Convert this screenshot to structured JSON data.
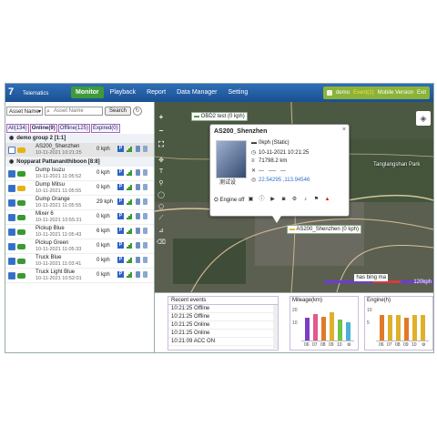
{
  "app": {
    "logo_mark": "7",
    "logo_text": "Telematics",
    "nav": [
      "Monitor",
      "Playback",
      "Report",
      "Data Manager",
      "Setting"
    ],
    "active_nav": "Monitor",
    "user": "demo",
    "event": "Event(1)",
    "mobile": "Mobile Version",
    "exit": "Exit"
  },
  "left": {
    "search_select": "Asset Name",
    "search_placeholder": "Asset Name",
    "search_button": "Search",
    "filters": [
      "All(134)",
      "Online(9)",
      "Offline(125)",
      "Expired(0)"
    ],
    "groups": [
      {
        "label": "demo group 2 [1:1]",
        "rows": [
          {
            "name": "AS200_Shenzhen",
            "time": "10-11-2021 10:21:25",
            "speed": "0 kph",
            "checked": false,
            "color": "#e7b214",
            "selected": true
          }
        ]
      },
      {
        "label": "Nopparat Pattananithiboon [8:8]",
        "rows": [
          {
            "name": "Dump Isuzu",
            "time": "10-11-2021 11:05:52",
            "speed": "0 kph",
            "checked": true,
            "color": "#3a9a2e"
          },
          {
            "name": "Dump Mitsu",
            "time": "10-11-2021 11:05:55",
            "speed": "0 kph",
            "checked": true,
            "color": "#e7b214"
          },
          {
            "name": "Dump Orange",
            "time": "10-11-2021 11:05:55",
            "speed": "29 kph",
            "checked": true,
            "color": "#3a9a2e"
          },
          {
            "name": "Mixer 6",
            "time": "10-11-2021 10:55:31",
            "speed": "0 kph",
            "checked": true,
            "color": "#3a9a2e"
          },
          {
            "name": "Pickup Blue",
            "time": "10-11-2021 11:05:43",
            "speed": "6 kph",
            "checked": true,
            "color": "#3a9a2e"
          },
          {
            "name": "Pickup Green",
            "time": "10-11-2021 11:05:33",
            "speed": "0 kph",
            "checked": true,
            "color": "#3a9a2e"
          },
          {
            "name": "Truck Blue",
            "time": "10-11-2021 11:03:41",
            "speed": "0 kph",
            "checked": true,
            "color": "#3a9a2e"
          },
          {
            "name": "Truck Light Blue",
            "time": "10-11-2021 10:52:01",
            "speed": "0 kph",
            "checked": true,
            "color": "#3a9a2e"
          }
        ]
      }
    ]
  },
  "map": {
    "label_top": "OBD2 test (0 kph)",
    "label_vehicle": "AS200_Shenzhen (0 kph)",
    "place_name": "Tanglangshan Park",
    "scale": "120kph",
    "scale_dist": "1 km",
    "map_link": "has bing ma",
    "popup": {
      "title": "AS200_Shenzhen",
      "caption": "测试设",
      "status": "0kph (Static)",
      "time": "10-11-2021 10:21:25",
      "mileage": "71798.2 km",
      "engine_line": "---   ----   ---",
      "location": "22.54295 ,113.94546",
      "engine_off": "Engine off"
    }
  },
  "bottom": {
    "events_header": "Recent events",
    "events": [
      "10:21:25 Offline",
      "10:21:25 Offline",
      "10:21:25 Online",
      "10:21:25 Online",
      "10:21:09 ACC ON"
    ],
    "mileage": {
      "title": "Mileage(km)",
      "x": [
        "06",
        "07",
        "08",
        "09",
        "10"
      ],
      "y_ticks": [
        "20",
        "10"
      ],
      "values": [
        16,
        19,
        17,
        20,
        15,
        13
      ],
      "colors": [
        "#7b3fc4",
        "#e05a8a",
        "#e07a2a",
        "#e0b02a",
        "#6fc44a",
        "#4ab0d8"
      ]
    },
    "engine": {
      "title": "Engine(h)",
      "x": [
        "06",
        "07",
        "08",
        "09",
        "10"
      ],
      "y_ticks": [
        "10",
        "5"
      ],
      "values": [
        9,
        9,
        9,
        8,
        9,
        9
      ],
      "colors": [
        "#e07a2a",
        "#e0b02a",
        "#e0b02a",
        "#e07a2a",
        "#e0b02a",
        "#e0b02a"
      ]
    }
  }
}
